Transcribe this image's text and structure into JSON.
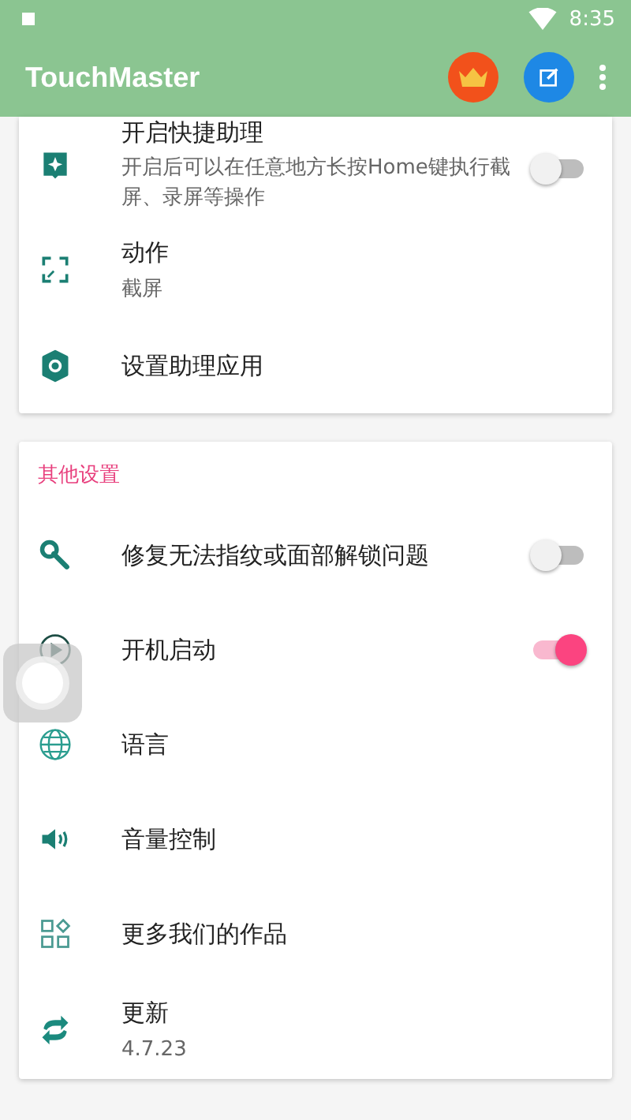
{
  "status_bar": {
    "time": "8:35"
  },
  "app_bar": {
    "title": "TouchMaster"
  },
  "sections": [
    {
      "rows": [
        {
          "kind": "toggle",
          "title": "开启快捷助理",
          "subtitle": "开启后可以在任意地方长按Home键执行截屏、录屏等操作",
          "on": false
        },
        {
          "kind": "plain",
          "title": "动作",
          "subtitle": "截屏"
        },
        {
          "kind": "plain",
          "title": "设置助理应用"
        }
      ]
    },
    {
      "header": "其他设置",
      "rows": [
        {
          "kind": "toggle",
          "title": "修复无法指纹或面部解锁问题",
          "on": false
        },
        {
          "kind": "toggle",
          "title": "开机启动",
          "on": true
        },
        {
          "kind": "plain",
          "title": "语言"
        },
        {
          "kind": "plain",
          "title": "音量控制"
        },
        {
          "kind": "plain",
          "title": "更多我们的作品"
        },
        {
          "kind": "plain",
          "title": "更新",
          "subtitle": "4.7.23"
        }
      ]
    }
  ]
}
